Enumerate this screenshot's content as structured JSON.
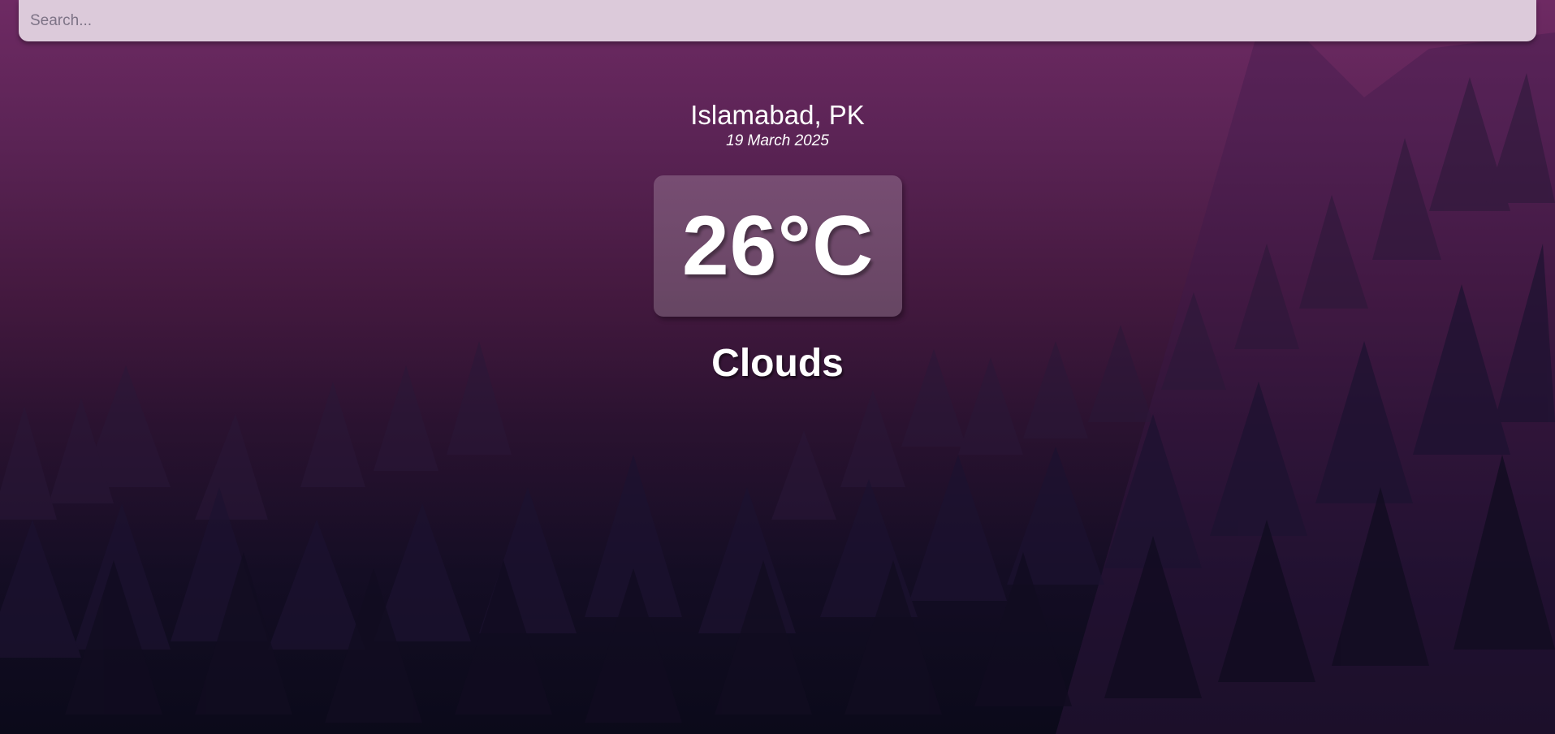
{
  "search": {
    "placeholder": "Search...",
    "value": ""
  },
  "location": {
    "city": "Islamabad, PK",
    "date": "19 March 2025"
  },
  "weather": {
    "temperature": "26°C",
    "condition": "Clouds"
  },
  "colors": {
    "background_top": "#6e2a63",
    "background_bottom": "#0b0a1a",
    "search_bar": "#dccada",
    "text": "#ffffff"
  }
}
